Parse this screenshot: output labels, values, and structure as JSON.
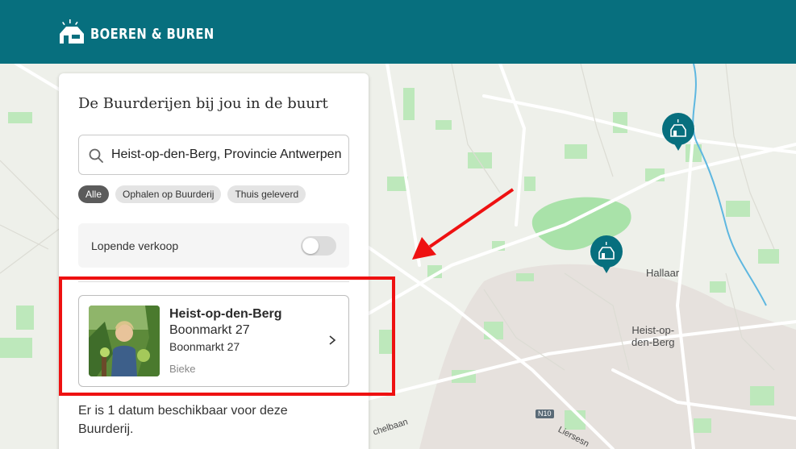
{
  "header": {
    "logo_text": "BOEREN & BUREN",
    "background_color": "#076f7e"
  },
  "map": {
    "labels": [
      {
        "text": "Hallaar"
      },
      {
        "text": "Heist-op-\nden-Berg"
      },
      {
        "text": "N10"
      },
      {
        "text": "chelbaan"
      },
      {
        "text": "Liersesn"
      }
    ],
    "pins": [
      "farm-pin-icon",
      "farm-pin-icon"
    ]
  },
  "panel": {
    "title": "De Buurderijen bij jou in de buurt",
    "search": {
      "value": "Heist-op-den-Berg, Provincie Antwerpen",
      "icon": "search-icon"
    },
    "filters": [
      "Alle",
      "Ophalen op Buurderij",
      "Thuis geleverd"
    ],
    "active_filter": "Alle",
    "toggle": {
      "label": "Lopende verkoop",
      "on": false
    },
    "farm": {
      "name": "Heist-op-den-Berg",
      "address_line1": "Boonmarkt 27",
      "address_line2": "Boonmarkt 27",
      "owner": "Bieke",
      "icon": "chevron-right-icon"
    },
    "availability_text": "Er is 1 datum beschikbaar voor deze Buurderij."
  },
  "annotation": {
    "color": "#ee1111"
  }
}
